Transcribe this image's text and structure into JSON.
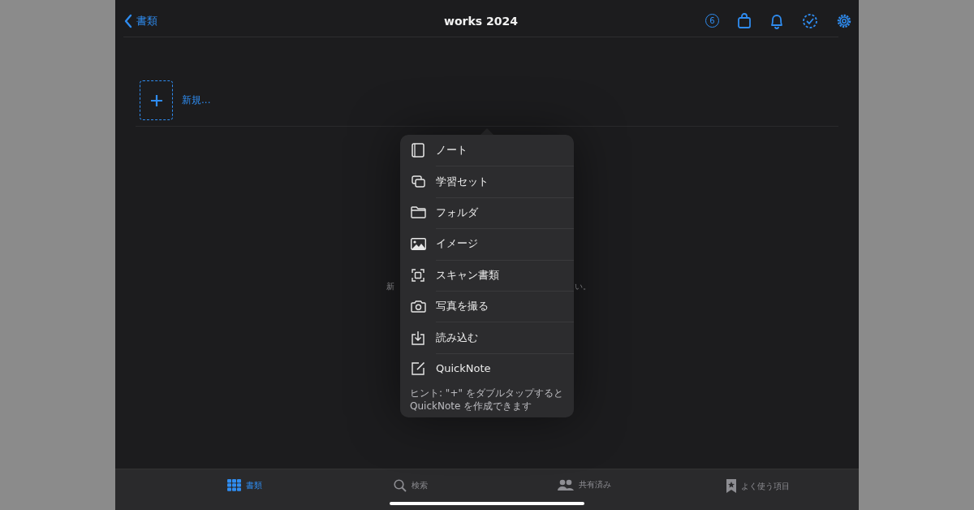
{
  "nav_bar": {
    "back_label": "書類",
    "title": "works 2024",
    "badge": "6"
  },
  "new_item": {
    "label": "新規..."
  },
  "empty_message": {
    "left_fragment": "新",
    "right_fragment": "い。"
  },
  "popover_menu": {
    "items": [
      {
        "label": "ノート",
        "kind": "notebook"
      },
      {
        "label": "学習セット",
        "kind": "cards"
      },
      {
        "label": "フォルダ",
        "kind": "folder"
      },
      {
        "label": "イメージ",
        "kind": "image"
      },
      {
        "label": "スキャン書類",
        "kind": "scan"
      },
      {
        "label": "写真を撮る",
        "kind": "camera"
      },
      {
        "label": "読み込む",
        "kind": "import"
      },
      {
        "label": "QuickNote",
        "kind": "quicknote"
      }
    ],
    "hint": "ヒント: \"+\" をダブルタップすると QuickNote を作成できます"
  },
  "tab_bar": [
    {
      "label": "書類",
      "kind": "grid",
      "selected": true
    },
    {
      "label": "検索",
      "kind": "search",
      "selected": false
    },
    {
      "label": "共有済み",
      "kind": "people",
      "selected": false
    },
    {
      "label": "よく使う項目",
      "kind": "bookmark",
      "selected": false
    }
  ]
}
